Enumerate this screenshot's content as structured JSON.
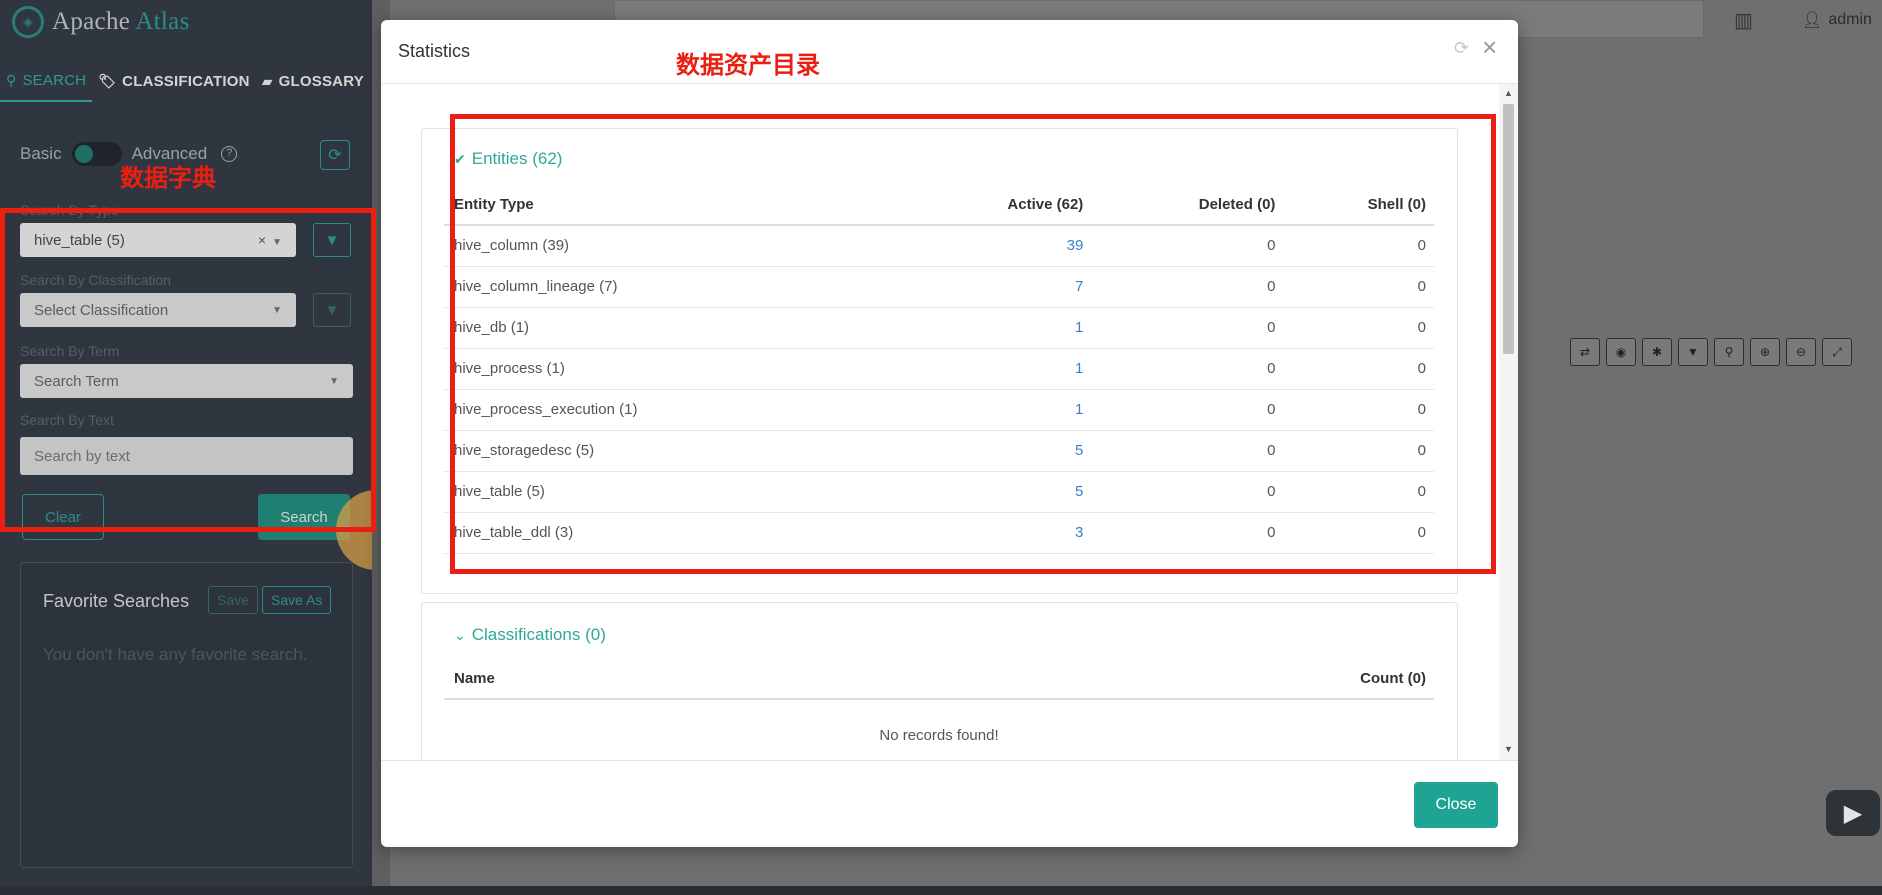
{
  "brand": {
    "name_part1": "Apache",
    "name_part2": "Atlas",
    "accent_color": "#2a8f82"
  },
  "sidebar": {
    "tabs": [
      {
        "label": "SEARCH",
        "icon": "search-icon"
      },
      {
        "label": "CLASSIFICATION",
        "icon": "tag-icon"
      },
      {
        "label": "GLOSSARY",
        "icon": "folder-icon"
      }
    ],
    "toggle": {
      "basic": "Basic",
      "advanced": "Advanced"
    },
    "search_by_type": {
      "label": "Search By Type",
      "value": "hive_table (5)"
    },
    "search_by_classification": {
      "label": "Search By Classification",
      "placeholder": "Select Classification"
    },
    "search_by_term": {
      "label": "Search By Term",
      "placeholder": "Search Term"
    },
    "search_by_text": {
      "label": "Search By Text",
      "placeholder": "Search by text"
    },
    "clear_label": "Clear",
    "search_label": "Search",
    "favorites": {
      "title": "Favorite Searches",
      "save_label": "Save",
      "save_as_label": "Save As",
      "empty_text": "You don't have any favorite search."
    }
  },
  "header": {
    "user": "admin"
  },
  "modal": {
    "title": "Statistics",
    "entities": {
      "title": "Entities (62)",
      "columns": [
        "Entity Type",
        "Active (62)",
        "Deleted (0)",
        "Shell (0)"
      ],
      "rows": [
        {
          "type": "hive_column (39)",
          "active": "39",
          "deleted": "0",
          "shell": "0"
        },
        {
          "type": "hive_column_lineage (7)",
          "active": "7",
          "deleted": "0",
          "shell": "0"
        },
        {
          "type": "hive_db (1)",
          "active": "1",
          "deleted": "0",
          "shell": "0"
        },
        {
          "type": "hive_process (1)",
          "active": "1",
          "deleted": "0",
          "shell": "0"
        },
        {
          "type": "hive_process_execution (1)",
          "active": "1",
          "deleted": "0",
          "shell": "0"
        },
        {
          "type": "hive_storagedesc (5)",
          "active": "5",
          "deleted": "0",
          "shell": "0"
        },
        {
          "type": "hive_table (5)",
          "active": "5",
          "deleted": "0",
          "shell": "0"
        },
        {
          "type": "hive_table_ddl (3)",
          "active": "3",
          "deleted": "0",
          "shell": "0"
        }
      ]
    },
    "classifications": {
      "title": "Classifications (0)",
      "columns": [
        "Name",
        "Count (0)"
      ],
      "empty_text": "No records found!"
    },
    "close_label": "Close"
  },
  "annotations": {
    "left_label": "数据字典",
    "modal_label": "数据资产目录",
    "color": "#ea1f12"
  }
}
